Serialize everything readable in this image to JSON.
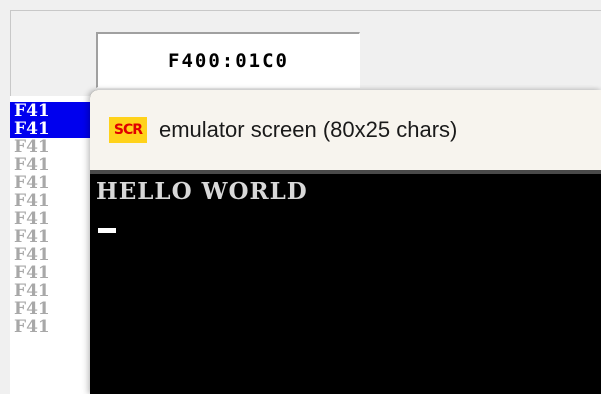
{
  "debugger": {
    "address_field": "F400:01C0",
    "address_rows": [
      "F41",
      "F41",
      "F41",
      "F41",
      "F41",
      "F41",
      "F41",
      "F41",
      "F41",
      "F41",
      "F41",
      "F41",
      "F41"
    ]
  },
  "emulator": {
    "icon_text": "SCR",
    "title": "emulator screen (80x25 chars)",
    "screen_lines": [
      "HELLO WORLD"
    ]
  },
  "colors": {
    "selection": "#0000ee",
    "icon_bg": "#ffd21a",
    "icon_fg": "#e00000",
    "screen_bg": "#000000",
    "screen_fg": "#d8d8d8"
  }
}
